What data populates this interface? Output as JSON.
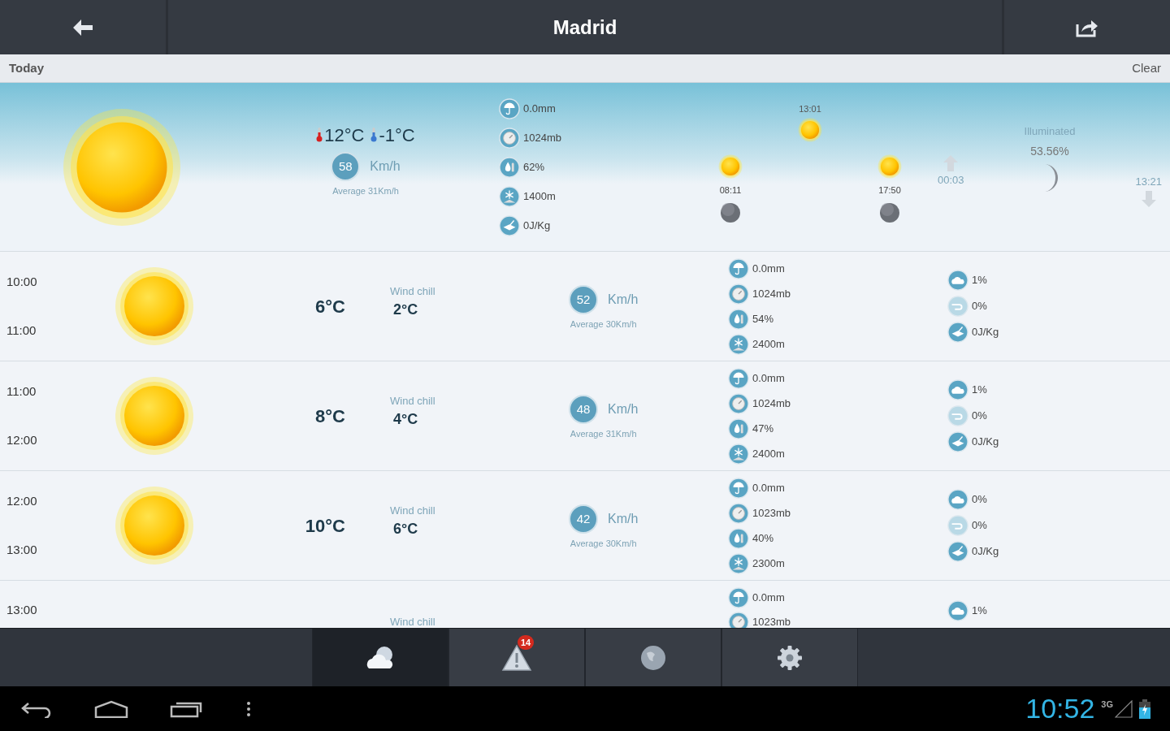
{
  "header": {
    "title": "Madrid"
  },
  "day_bar": {
    "label": "Today",
    "condition": "Clear"
  },
  "today": {
    "max": "12°C",
    "min": "-1°C",
    "wind": {
      "speed": "58",
      "unit": "Km/h",
      "average": "Average 31Km/h"
    },
    "stats": [
      {
        "kind": "rain",
        "value": "0.0mm"
      },
      {
        "kind": "pressure",
        "value": "1024mb"
      },
      {
        "kind": "humidity",
        "value": "62%"
      },
      {
        "kind": "snow",
        "value": "1400m"
      },
      {
        "kind": "energy",
        "value": "0J/Kg"
      }
    ],
    "sun": {
      "noon": "13:01",
      "rise": "08:11",
      "set": "17:50"
    },
    "moon": {
      "rise": "00:03",
      "illuminated_label": "Illuminated",
      "illuminated": "53.56%",
      "set": "13:21"
    }
  },
  "hours": [
    {
      "from": "10:00",
      "to": "11:00",
      "temp": "6°C",
      "chill_label": "Wind chill",
      "chill": "2°C",
      "wind": {
        "speed": "52",
        "unit": "Km/h",
        "average": "Average 30Km/h"
      },
      "stats": [
        {
          "kind": "rain",
          "value": "0.0mm"
        },
        {
          "kind": "pressure",
          "value": "1024mb"
        },
        {
          "kind": "humidity",
          "value": "54%"
        },
        {
          "kind": "snow",
          "value": "2400m"
        }
      ],
      "extra": [
        {
          "kind": "cloud",
          "value": "1%"
        },
        {
          "kind": "fog",
          "value": "0%"
        },
        {
          "kind": "energy",
          "value": "0J/Kg"
        }
      ]
    },
    {
      "from": "11:00",
      "to": "12:00",
      "temp": "8°C",
      "chill_label": "Wind chill",
      "chill": "4°C",
      "wind": {
        "speed": "48",
        "unit": "Km/h",
        "average": "Average 31Km/h"
      },
      "stats": [
        {
          "kind": "rain",
          "value": "0.0mm"
        },
        {
          "kind": "pressure",
          "value": "1024mb"
        },
        {
          "kind": "humidity",
          "value": "47%"
        },
        {
          "kind": "snow",
          "value": "2400m"
        }
      ],
      "extra": [
        {
          "kind": "cloud",
          "value": "1%"
        },
        {
          "kind": "fog",
          "value": "0%"
        },
        {
          "kind": "energy",
          "value": "0J/Kg"
        }
      ]
    },
    {
      "from": "12:00",
      "to": "13:00",
      "temp": "10°C",
      "chill_label": "Wind chill",
      "chill": "6°C",
      "wind": {
        "speed": "42",
        "unit": "Km/h",
        "average": "Average 30Km/h"
      },
      "stats": [
        {
          "kind": "rain",
          "value": "0.0mm"
        },
        {
          "kind": "pressure",
          "value": "1023mb"
        },
        {
          "kind": "humidity",
          "value": "40%"
        },
        {
          "kind": "snow",
          "value": "2300m"
        }
      ],
      "extra": [
        {
          "kind": "cloud",
          "value": "0%"
        },
        {
          "kind": "fog",
          "value": "0%"
        },
        {
          "kind": "energy",
          "value": "0J/Kg"
        }
      ]
    }
  ],
  "partial_hour": {
    "from": "13:00",
    "chill_label": "Wind chill",
    "stats": [
      {
        "kind": "rain",
        "value": "0.0mm"
      },
      {
        "kind": "pressure",
        "value": "1023mb"
      }
    ],
    "extra": [
      {
        "kind": "cloud",
        "value": "1%"
      }
    ]
  },
  "tabs": [
    {
      "kind": "forecast",
      "selected": true
    },
    {
      "kind": "alerts",
      "selected": false,
      "badge": "14"
    },
    {
      "kind": "globe",
      "selected": false
    },
    {
      "kind": "settings",
      "selected": false
    }
  ],
  "status_bar": {
    "time": "10:52",
    "network": "3G"
  }
}
